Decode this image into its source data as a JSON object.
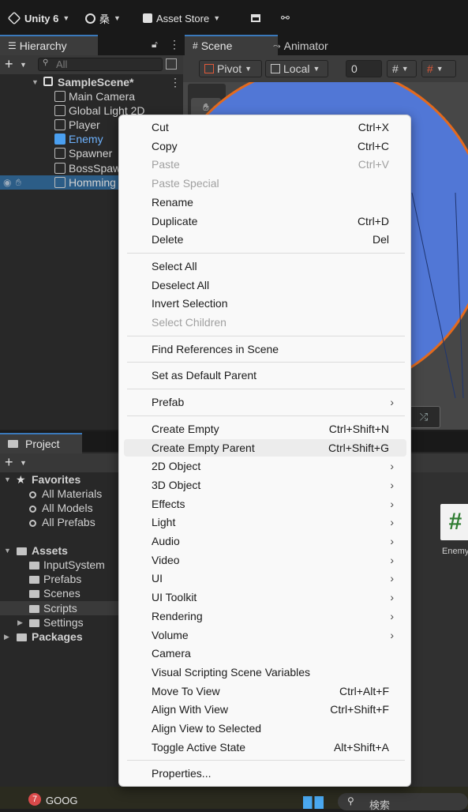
{
  "toolbar": {
    "app": "Unity 6",
    "account": "桑",
    "asset_store": "Asset Store"
  },
  "hierarchy": {
    "tab": "Hierarchy",
    "search_placeholder": "All",
    "scene": "SampleScene*",
    "items": [
      "Main Camera",
      "Global Light 2D",
      "Player",
      "Enemy",
      "Spawner",
      "BossSpaw",
      "Homming"
    ]
  },
  "scene": {
    "tabs": [
      "Scene",
      "Animator"
    ],
    "pivot": "Pivot",
    "local": "Local",
    "grid_value": "0"
  },
  "project": {
    "tab": "Project",
    "favorites": "Favorites",
    "fav_items": [
      "All Materials",
      "All Models",
      "All Prefabs"
    ],
    "assets": "Assets",
    "asset_items": [
      "InputSystem",
      "Prefabs",
      "Scenes",
      "Scripts",
      "Settings"
    ],
    "packages": "Packages",
    "script_name": "Enemy"
  },
  "taskbar": {
    "badge": "7",
    "ticker": "GOOG",
    "search": "検索"
  },
  "menu": {
    "groups": [
      [
        {
          "label": "Cut",
          "shortcut": "Ctrl+X"
        },
        {
          "label": "Copy",
          "shortcut": "Ctrl+C"
        },
        {
          "label": "Paste",
          "shortcut": "Ctrl+V",
          "disabled": true
        },
        {
          "label": "Paste Special",
          "shortcut": "",
          "disabled": true
        },
        {
          "label": "Rename",
          "shortcut": ""
        },
        {
          "label": "Duplicate",
          "shortcut": "Ctrl+D"
        },
        {
          "label": "Delete",
          "shortcut": "Del"
        }
      ],
      [
        {
          "label": "Select All",
          "shortcut": ""
        },
        {
          "label": "Deselect All",
          "shortcut": ""
        },
        {
          "label": "Invert Selection",
          "shortcut": ""
        },
        {
          "label": "Select Children",
          "shortcut": "",
          "disabled": true
        }
      ],
      [
        {
          "label": "Find References in Scene",
          "shortcut": ""
        }
      ],
      [
        {
          "label": "Set as Default Parent",
          "shortcut": ""
        }
      ],
      [
        {
          "label": "Prefab",
          "shortcut": "",
          "submenu": true
        }
      ],
      [
        {
          "label": "Create Empty",
          "shortcut": "Ctrl+Shift+N"
        },
        {
          "label": "Create Empty Parent",
          "shortcut": "Ctrl+Shift+G",
          "highlighted": true
        },
        {
          "label": "2D Object",
          "shortcut": "",
          "submenu": true
        },
        {
          "label": "3D Object",
          "shortcut": "",
          "submenu": true
        },
        {
          "label": "Effects",
          "shortcut": "",
          "submenu": true
        },
        {
          "label": "Light",
          "shortcut": "",
          "submenu": true
        },
        {
          "label": "Audio",
          "shortcut": "",
          "submenu": true
        },
        {
          "label": "Video",
          "shortcut": "",
          "submenu": true
        },
        {
          "label": "UI",
          "shortcut": "",
          "submenu": true
        },
        {
          "label": "UI Toolkit",
          "shortcut": "",
          "submenu": true
        },
        {
          "label": "Rendering",
          "shortcut": "",
          "submenu": true
        },
        {
          "label": "Volume",
          "shortcut": "",
          "submenu": true
        },
        {
          "label": "Camera",
          "shortcut": ""
        },
        {
          "label": "Visual Scripting Scene Variables",
          "shortcut": ""
        },
        {
          "label": "Move To View",
          "shortcut": "Ctrl+Alt+F"
        },
        {
          "label": "Align With View",
          "shortcut": "Ctrl+Shift+F"
        },
        {
          "label": "Align View to Selected",
          "shortcut": ""
        },
        {
          "label": "Toggle Active State",
          "shortcut": "Alt+Shift+A"
        }
      ],
      [
        {
          "label": "Properties...",
          "shortcut": ""
        }
      ]
    ]
  },
  "colors": {
    "accent": "#3a79bb",
    "selection": "#2c5d87",
    "enemy_text": "#6eb3ff",
    "scene_circle": "#5177d6",
    "scene_outline": "#e46a1d"
  }
}
